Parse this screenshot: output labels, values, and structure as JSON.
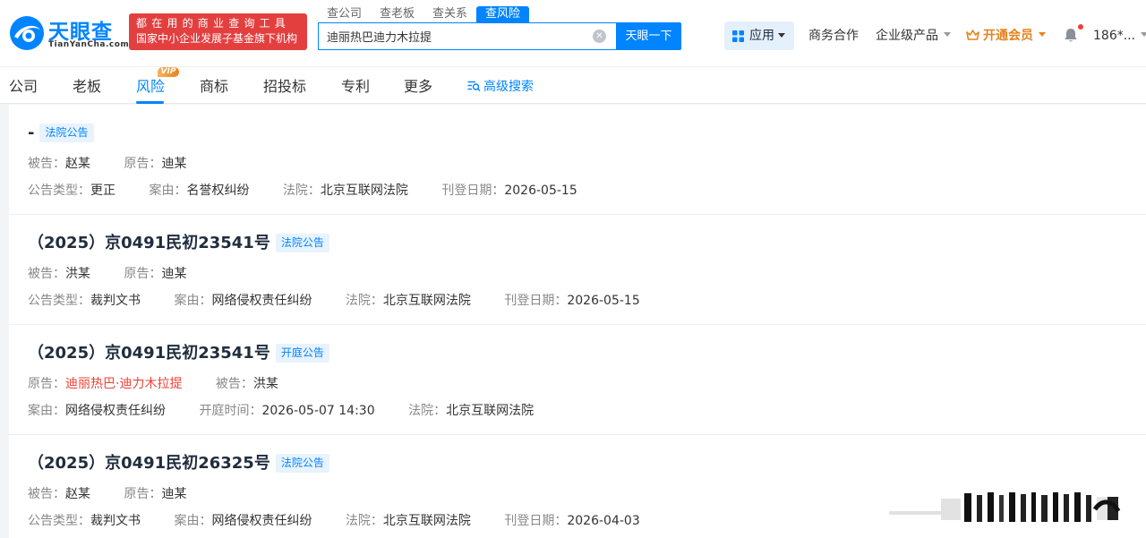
{
  "header": {
    "logo_cn": "天眼查",
    "logo_en": "TianYanCha.com",
    "promo_line1": "都在用的商业查询工具",
    "promo_line2": "国家中小企业发展子基金旗下机构",
    "search_tabs": [
      "查公司",
      "查老板",
      "查关系",
      "查风险"
    ],
    "search_value": "迪丽热巴迪力木拉提",
    "clear_symbol": "✕",
    "search_button": "天眼一下",
    "apps_label": "应用",
    "biz_coop": "商务合作",
    "enterprise": "企业级产品",
    "vip_label": "开通会员",
    "user": "186*...",
    "brand_color": "#0084ff"
  },
  "subnav": {
    "items": [
      "公司",
      "老板",
      "风险",
      "商标",
      "招投标",
      "专利",
      "更多"
    ],
    "active": "风险",
    "vip_badge": "VIP",
    "advanced": "高级搜索"
  },
  "records": [
    {
      "title": "-",
      "tag": "法院公告",
      "line1": [
        {
          "k": "被告：",
          "v": "赵某"
        },
        {
          "k": "原告：",
          "v": "迪某"
        }
      ],
      "line2": [
        {
          "k": "公告类型：",
          "v": "更正"
        },
        {
          "k": "案由：",
          "v": "名誉权纠纷"
        },
        {
          "k": "法院：",
          "v": "北京互联网法院"
        },
        {
          "k": "刊登日期：",
          "v": "2026-05-15"
        }
      ]
    },
    {
      "title": "（2025）京0491民初23541号",
      "tag": "法院公告",
      "line1": [
        {
          "k": "被告：",
          "v": "洪某"
        },
        {
          "k": "原告：",
          "v": "迪某"
        }
      ],
      "line2": [
        {
          "k": "公告类型：",
          "v": "裁判文书"
        },
        {
          "k": "案由：",
          "v": "网络侵权责任纠纷"
        },
        {
          "k": "法院：",
          "v": "北京互联网法院"
        },
        {
          "k": "刊登日期：",
          "v": "2026-05-15"
        }
      ]
    },
    {
      "title": "（2025）京0491民初23541号",
      "tag": "开庭公告",
      "line1": [
        {
          "k": "原告：",
          "v": "迪丽热巴·迪力木拉提",
          "red": true
        },
        {
          "k": "被告：",
          "v": "洪某"
        }
      ],
      "line2": [
        {
          "k": "案由：",
          "v": "网络侵权责任纠纷"
        },
        {
          "k": "开庭时间：",
          "v": "2026-05-07 14:30"
        },
        {
          "k": "法院：",
          "v": "北京互联网法院"
        }
      ]
    },
    {
      "title": "（2025）京0491民初26325号",
      "tag": "法院公告",
      "line1": [
        {
          "k": "被告：",
          "v": "赵某"
        },
        {
          "k": "原告：",
          "v": "迪某"
        }
      ],
      "line2": [
        {
          "k": "公告类型：",
          "v": "裁判文书"
        },
        {
          "k": "案由：",
          "v": "网络侵权责任纠纷"
        },
        {
          "k": "法院：",
          "v": "北京互联网法院"
        },
        {
          "k": "刊登日期：",
          "v": "2026-04-03"
        }
      ]
    }
  ]
}
